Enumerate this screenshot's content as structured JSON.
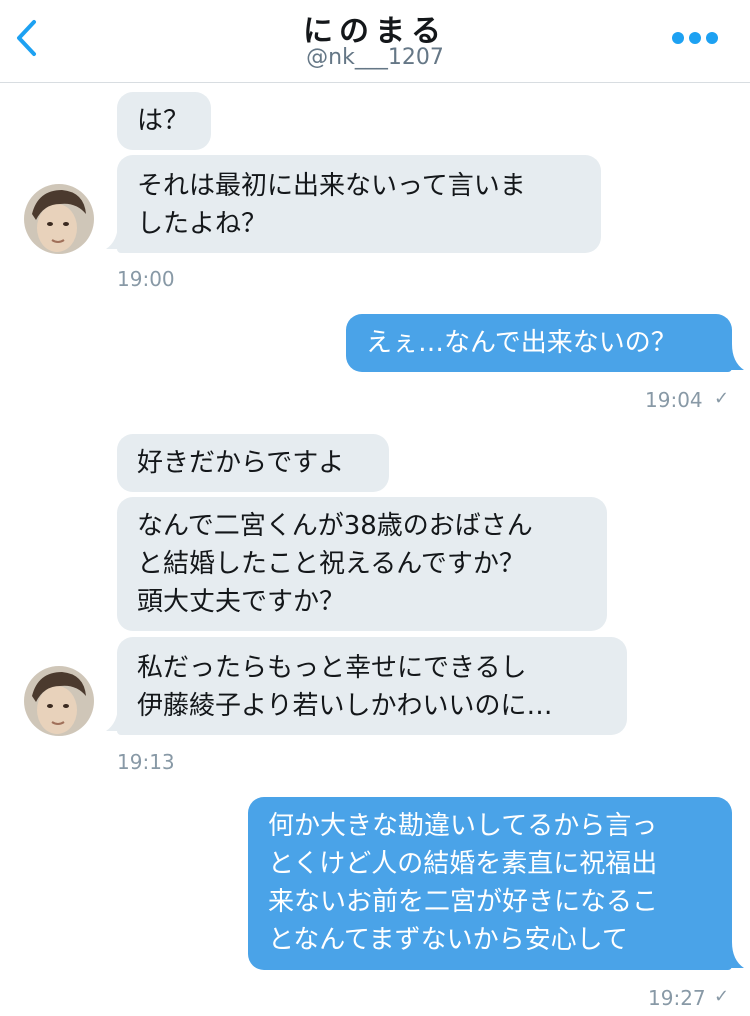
{
  "header": {
    "title": "にのまる",
    "handle": "@nk___1207"
  },
  "messages": [
    {
      "text": "は？"
    },
    {
      "text": "それは最初に出来ないって言いま\nしたよね？"
    },
    {
      "text": "えぇ…なんで出来ないの？"
    },
    {
      "text": "好きだからですよ"
    },
    {
      "text": "なんで二宮くんが38歳のおばさん\nと結婚したこと祝えるんですか？\n頭大丈夫ですか？"
    },
    {
      "text": "私だったらもっと幸せにできるし\n伊藤綾子より若いしかわいいのに…"
    },
    {
      "text": "何か大きな勘違いしてるから言っ\nとくけど人の結婚を素直に祝福出\n来ないお前を二宮が好きになるこ\nとなんてまずないから安心して"
    }
  ],
  "timestamps": {
    "t1": "19:00",
    "t2": "19:04",
    "t3": "19:13",
    "t4": "19:27"
  },
  "colors": {
    "accent": "#1da1f2",
    "outgoing_bubble": "#4aa3e8",
    "incoming_bubble": "#e6ecf0"
  },
  "icons": {
    "back": "chevron-left-icon",
    "more": "more-dots-icon",
    "read": "check-icon"
  }
}
